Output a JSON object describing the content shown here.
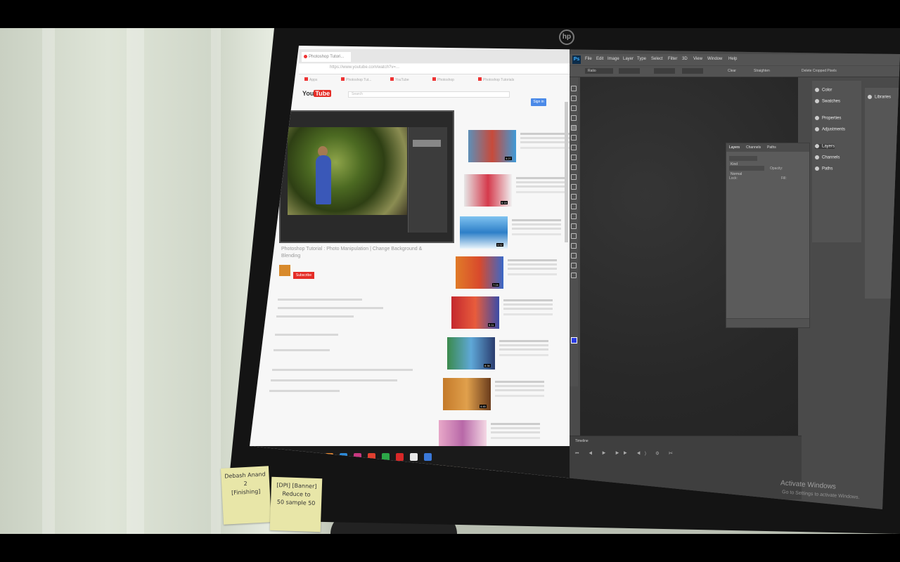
{
  "browser": {
    "tab_label": "Photoshop Tutori...",
    "url": "https://www.youtube.com/watch?v=...",
    "bookmarks": [
      "Apps",
      "Photoshop Tut...",
      "YouTube",
      "Photoshop",
      "Photoshop Tutorials"
    ],
    "yt_logo_prefix": "You",
    "yt_logo_box": "Tube",
    "search_placeholder": "Search",
    "signin_label": "Sign in",
    "video_title": "Photoshop Tutorial : Photo Manipulation | Change Background & Blending",
    "subscribe_label": "Subscribe",
    "sidebar_times": [
      "4:27",
      "6:18",
      "3:52",
      "7:04",
      "5:11",
      "8:36",
      "4:45",
      "6:02",
      "9:13"
    ]
  },
  "photoshop": {
    "logo": "Ps",
    "menus": [
      "File",
      "Edit",
      "Image",
      "Layer",
      "Type",
      "Select",
      "Filter",
      "3D",
      "View",
      "Window",
      "Help"
    ],
    "options": {
      "preset": "Ratio",
      "clear_label": "Clear",
      "straighten_label": "Straighten",
      "delete_label": "Delete Cropped Pixels"
    },
    "layers_tabs": [
      "Layers",
      "Channels",
      "Paths"
    ],
    "layers_kind": "Kind",
    "layers_blend": "Normal",
    "layers_opacity": "Opacity:",
    "layers_lock": "Lock:",
    "layers_fill": "Fill:",
    "dock_items": [
      "Color",
      "Swatches",
      "Properties",
      "Adjustments",
      "Layers",
      "Channels",
      "Paths"
    ],
    "library_label": "Libraries",
    "timeline_title": "Timeline",
    "timeline_controls": "⏮ ◀ ▶ ▶▶ ◀) ⚙ ✂"
  },
  "watermark": {
    "title": "Activate Windows",
    "subtitle": "Go to Settings to activate Windows."
  },
  "sticky_notes": {
    "left": [
      "Debash Anand",
      "2",
      "[Finishing]"
    ],
    "right": [
      "[DPI] [Banner]",
      "Reduce to",
      "50 sample 50"
    ]
  },
  "colors": {
    "youtube_red": "#e52d27",
    "ps_blue": "#3fb0ff",
    "sticky": "#e8e6a8"
  }
}
